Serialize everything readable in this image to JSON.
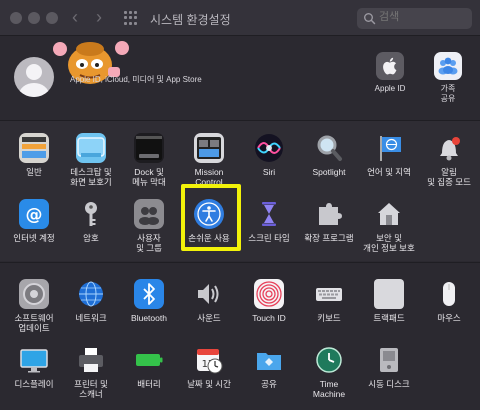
{
  "window": {
    "title": "시스템 환경설정",
    "search_placeholder": "검색"
  },
  "user": {
    "subtitle": "Apple ID, iCloud, 미디어 및 App Store"
  },
  "account_items": [
    {
      "label": "Apple ID"
    },
    {
      "label": "가족\n공유"
    }
  ],
  "row1": [
    {
      "label": "일반"
    },
    {
      "label": "데스크탑 및\n화면 보호기"
    },
    {
      "label": "Dock 및\n메뉴 막대"
    },
    {
      "label": "Mission\nControl"
    },
    {
      "label": "Siri"
    },
    {
      "label": "Spotlight"
    },
    {
      "label": "언어 및 지역"
    },
    {
      "label": "알림\n및 집중 모드"
    }
  ],
  "row2": [
    {
      "label": "인터넷 계정"
    },
    {
      "label": "암호"
    },
    {
      "label": "사용자\n및 그룹"
    },
    {
      "label": "손쉬운 사용"
    },
    {
      "label": "스크린 타임"
    },
    {
      "label": "확장 프로그램"
    },
    {
      "label": "보안 및\n개인 정보 보호"
    }
  ],
  "row3": [
    {
      "label": "소프트웨어\n업데이트"
    },
    {
      "label": "네트워크"
    },
    {
      "label": "Bluetooth"
    },
    {
      "label": "사운드"
    },
    {
      "label": "Touch ID"
    },
    {
      "label": "키보드"
    },
    {
      "label": "트랙패드"
    },
    {
      "label": "마우스"
    }
  ],
  "row4": [
    {
      "label": "디스플레이"
    },
    {
      "label": "프린터 및\n스캐너"
    },
    {
      "label": "배터리"
    },
    {
      "label": "날짜 및 시간"
    },
    {
      "label": "공유"
    },
    {
      "label": "Time\nMachine"
    },
    {
      "label": "시동 디스크"
    }
  ],
  "calendar_day": "17",
  "colors": {
    "highlight": "#f2f20a",
    "accent_blue": "#2f7de1"
  }
}
